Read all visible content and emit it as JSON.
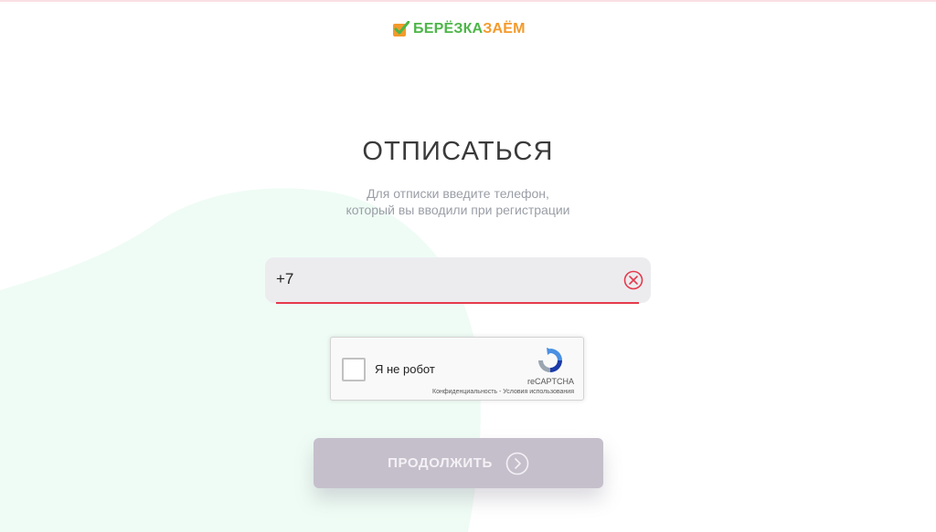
{
  "brand": {
    "part1": "БЕРЁЗКА",
    "part2": "ЗАЁМ",
    "green": "#4cb648",
    "orange": "#f39a2b"
  },
  "unsubscribe": {
    "title": "ОТПИСАТЬСЯ",
    "subtitle_line1": "Для отписки введите телефон,",
    "subtitle_line2": "который вы вводили при регистрации"
  },
  "phone": {
    "value": "+7",
    "clear_icon": "clear-circle-x-icon",
    "error_color": "#e53a4c"
  },
  "recaptcha": {
    "label": "Я не робот",
    "brand": "reCAPTCHA",
    "privacy": "Конфиденциальность",
    "separator": " - ",
    "terms": "Условия использования"
  },
  "continue": {
    "label": "ПРОДОЛЖИТЬ",
    "icon": "arrow-right-circle-icon"
  }
}
